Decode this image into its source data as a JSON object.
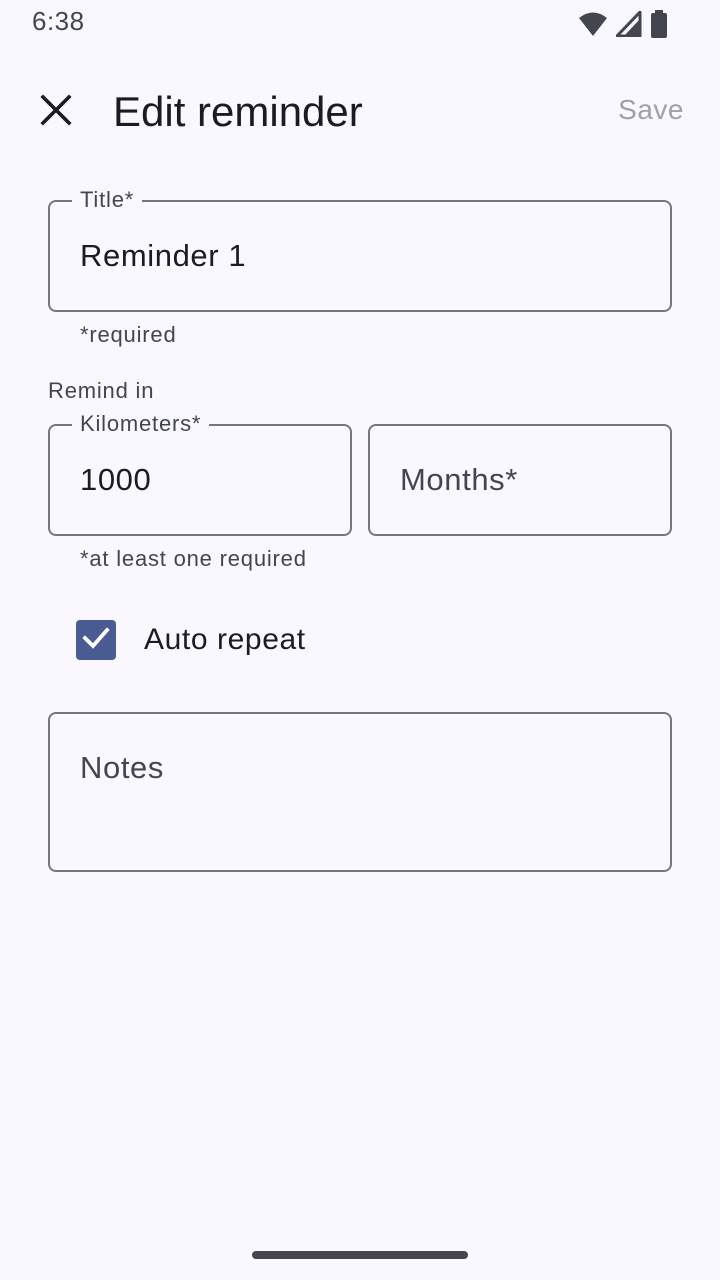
{
  "status_bar": {
    "time": "6:38"
  },
  "app_bar": {
    "title": "Edit reminder",
    "save_label": "Save",
    "close_icon": "close-icon"
  },
  "form": {
    "title_field": {
      "label": "Title*",
      "value": "Reminder 1",
      "helper": "*required"
    },
    "remind_in_label": "Remind in",
    "kilometers_field": {
      "label": "Kilometers*",
      "value": "1000"
    },
    "months_field": {
      "placeholder": "Months*"
    },
    "interval_helper": "*at least one required",
    "auto_repeat": {
      "label": "Auto repeat",
      "checked": true
    },
    "notes_field": {
      "placeholder": "Notes"
    }
  },
  "colors": {
    "background": "#f8f8fe",
    "outline": "#75767f",
    "checkbox_fill": "#4a5a92",
    "save_disabled": "#a0a0a6"
  }
}
